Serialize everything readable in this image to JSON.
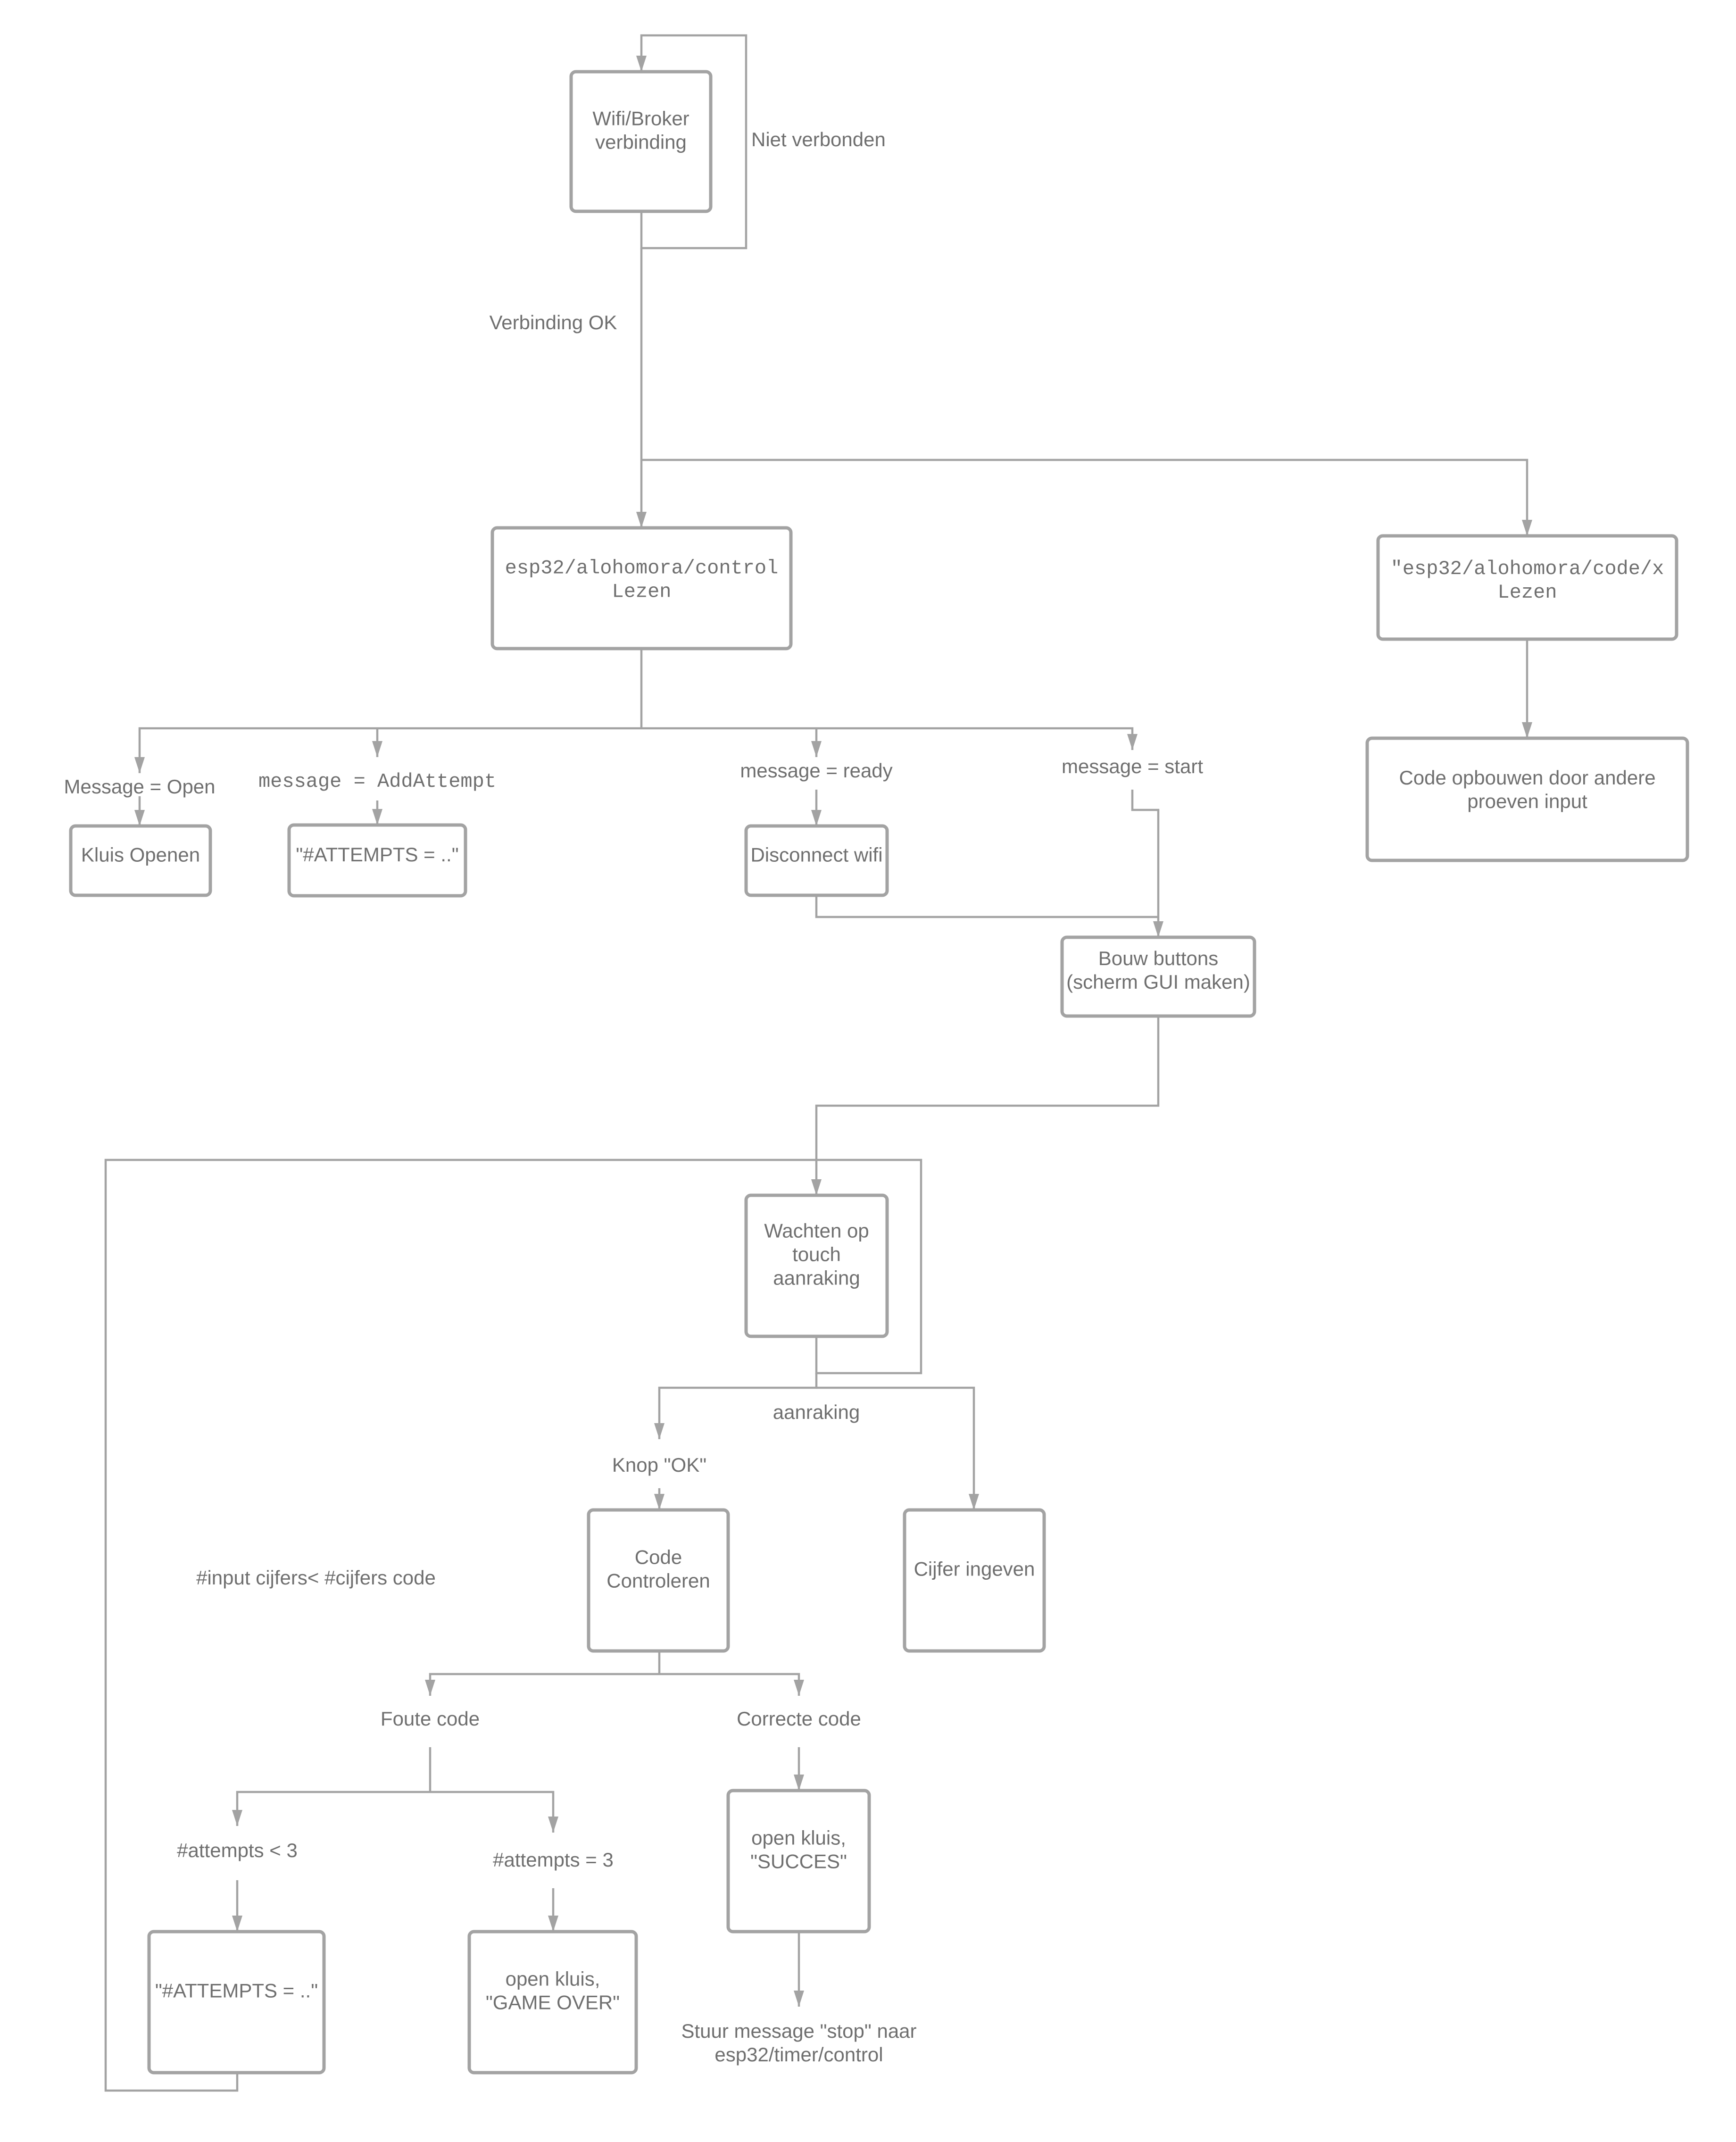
{
  "diagram": {
    "type": "flowchart",
    "nodes": {
      "wifi": {
        "lines": [
          "Wifi/Broker",
          "verbinding"
        ]
      },
      "control": {
        "lines": [
          "esp32/alohomora/control",
          "Lezen"
        ],
        "mono": true
      },
      "code_topic": {
        "lines": [
          "\"esp32/alohomora/code/x",
          "Lezen"
        ],
        "mono": true
      },
      "code_build": {
        "lines": [
          "Code opbouwen door andere",
          "proeven input"
        ]
      },
      "kluis_openen": {
        "lines": [
          "Kluis Openen"
        ]
      },
      "attempts_top": {
        "lines": [
          "\"#ATTEMPTS = ..\""
        ]
      },
      "disconnect": {
        "lines": [
          "Disconnect wifi"
        ]
      },
      "bouw": {
        "lines": [
          "Bouw buttons",
          "(scherm GUI maken)"
        ]
      },
      "wachten": {
        "lines": [
          "Wachten op",
          "touch",
          "aanraking"
        ]
      },
      "code_ctrl": {
        "lines": [
          "Code",
          "Controleren"
        ]
      },
      "cijfer": {
        "lines": [
          "Cijfer ingeven"
        ]
      },
      "succes": {
        "lines": [
          "open kluis,",
          "\"SUCCES\""
        ]
      },
      "attempts_bottom": {
        "lines": [
          "\"#ATTEMPTS = ..\""
        ]
      },
      "game_over": {
        "lines": [
          "open kluis,",
          "\"GAME OVER\""
        ]
      }
    },
    "labels": {
      "niet_verbonden": {
        "lines": [
          "Niet verbonden"
        ]
      },
      "verbinding_ok": {
        "lines": [
          "Verbinding OK"
        ]
      },
      "msg_open": {
        "lines": [
          "Message = Open"
        ]
      },
      "msg_addattempt": {
        "lines": [
          "message = AddAttempt"
        ],
        "mono": true
      },
      "msg_ready": {
        "lines": [
          "message = ready"
        ]
      },
      "msg_start": {
        "lines": [
          "message = start"
        ]
      },
      "aanraking": {
        "lines": [
          "aanraking"
        ]
      },
      "knop_ok": {
        "lines": [
          "Knop \"OK\""
        ]
      },
      "input_cijfers": {
        "lines": [
          "#input cijfers< #cijfers code"
        ]
      },
      "foute_code": {
        "lines": [
          "Foute code"
        ]
      },
      "correcte_code": {
        "lines": [
          "Correcte code"
        ]
      },
      "attempts_lt3": {
        "lines": [
          "#attempts < 3"
        ]
      },
      "attempts_eq3": {
        "lines": [
          "#attempts = 3"
        ]
      },
      "stuur_stop": {
        "lines": [
          "Stuur message \"stop\" naar",
          "esp32/timer/control"
        ]
      }
    }
  }
}
